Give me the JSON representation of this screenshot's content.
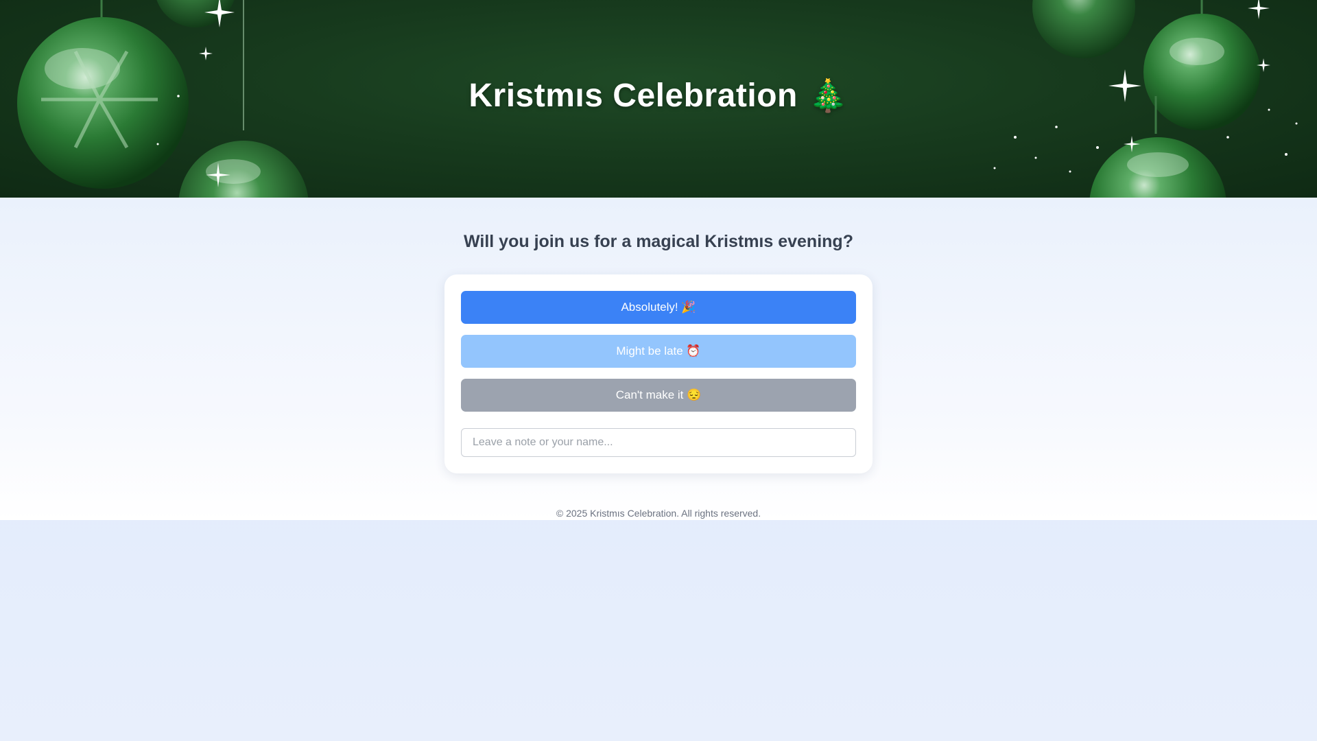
{
  "header": {
    "title": "Kristmıs Celebration",
    "title_emoji": "🎄"
  },
  "main": {
    "question": "Will you join us for a magical Kristmıs evening?"
  },
  "rsvp": {
    "yes_label": "Absolutely! 🎉",
    "late_label": "Might be late ⏰",
    "no_label": "Can't make it 😔",
    "note_placeholder": "Leave a note or your name...",
    "note_value": ""
  },
  "footer": {
    "copyright": "© 2025 Kristmıs Celebration. All rights reserved."
  },
  "colors": {
    "banner_green": "#173a1d",
    "ornament_green": "#2e7d3a",
    "primary_blue": "#3b82f6",
    "light_blue": "#93c5fd",
    "gray": "#9ca3af"
  }
}
